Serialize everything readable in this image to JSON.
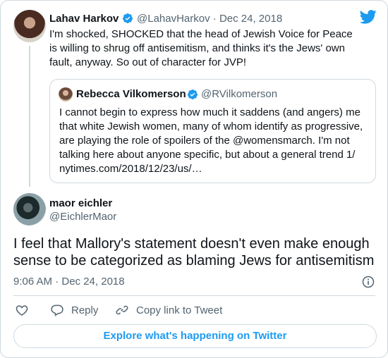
{
  "embed": {
    "logo": "twitter-bird-icon",
    "accent": "#1d9bf0",
    "text_primary": "#0f1419",
    "text_secondary": "#536471",
    "border": "#cfd9de"
  },
  "parent_tweet": {
    "name": "Lahav Harkov",
    "handle_date": "@LahavHarkov · Dec 24, 2018",
    "text": "I'm shocked, SHOCKED that the head of Jewish Voice for Peace is willing to shrug off antisemitism, and thinks it's the Jews' own fault, anyway. So out of character for JVP!"
  },
  "quoted_tweet": {
    "name": "Rebecca Vilkomerson",
    "handle": "@RVilkomerson",
    "text": "I cannot begin to express how much it saddens (and angers) me that white Jewish women, many of whom identify as progressive, are playing the role of spoilers of the @womensmarch.  I'm not talking here about anyone specific, but about a general trend 1/ nytimes.com/2018/12/23/us/…"
  },
  "main_tweet": {
    "name": "maor eichler",
    "handle": "@EichlerMaor",
    "text": "I feel that Mallory's statement doesn't even make enough sense to be categorized as blaming Jews for antisemitism",
    "timestamp": "9:06 AM · Dec 24, 2018"
  },
  "actions": {
    "reply_label": "Reply",
    "copy_label": "Copy link to Tweet"
  },
  "explore_label": "Explore what's happening on Twitter"
}
